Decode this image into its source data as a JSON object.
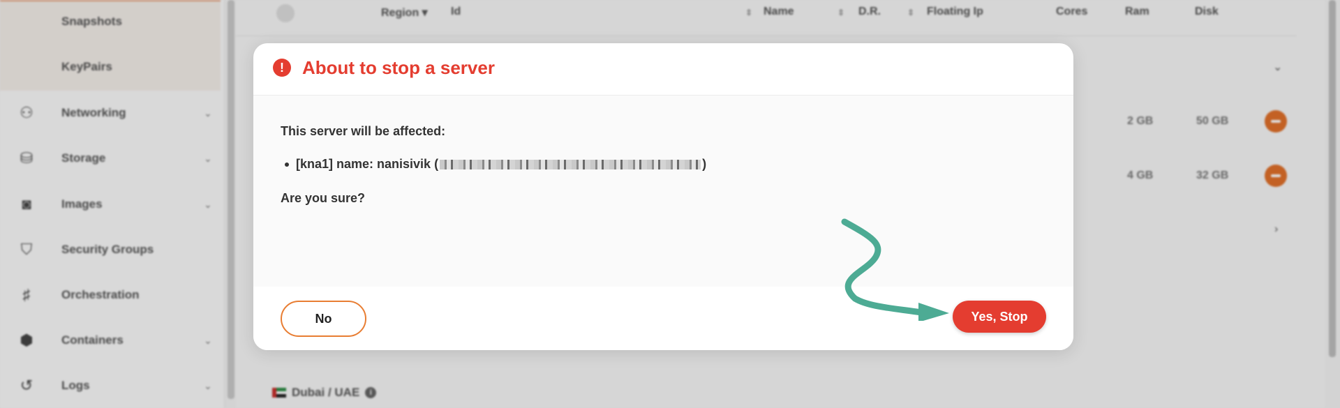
{
  "sidebar": {
    "sub_items": [
      "Snapshots",
      "KeyPairs"
    ],
    "items": [
      {
        "label": "Networking",
        "icon": "network-icon",
        "glyph": "⚇",
        "expandable": true
      },
      {
        "label": "Storage",
        "icon": "database-icon",
        "glyph": "⛁",
        "expandable": true
      },
      {
        "label": "Images",
        "icon": "camera-icon",
        "glyph": "◙",
        "expandable": true
      },
      {
        "label": "Security Groups",
        "icon": "shield-icon",
        "glyph": "⛉",
        "expandable": false
      },
      {
        "label": "Orchestration",
        "icon": "orchestration-icon",
        "glyph": "♯",
        "expandable": false
      },
      {
        "label": "Containers",
        "icon": "cube-icon",
        "glyph": "⬢",
        "expandable": true
      },
      {
        "label": "Logs",
        "icon": "history-icon",
        "glyph": "↺",
        "expandable": true
      }
    ]
  },
  "table": {
    "headers": {
      "region": "Region",
      "id": "Id",
      "name": "Name",
      "dr": "D.R.",
      "floating_ip": "Floating Ip",
      "cores": "Cores",
      "ram": "Ram",
      "disk": "Disk"
    },
    "rows": [
      {
        "ram": "2 GB",
        "disk": "50 GB"
      },
      {
        "ram": "4 GB",
        "disk": "32 GB"
      }
    ],
    "region_footer": "Dubai / UAE"
  },
  "modal": {
    "title": "About to stop a server",
    "intro": "This server will be affected:",
    "item_prefix": "[kna1] name: nanisivik (",
    "item_suffix": ")",
    "question": "Are you sure?",
    "cancel_label": "No",
    "confirm_label": "Yes, Stop"
  },
  "colors": {
    "danger": "#e43d30",
    "accent_orange": "#e87d32",
    "annotation_arrow": "#4dab94"
  }
}
